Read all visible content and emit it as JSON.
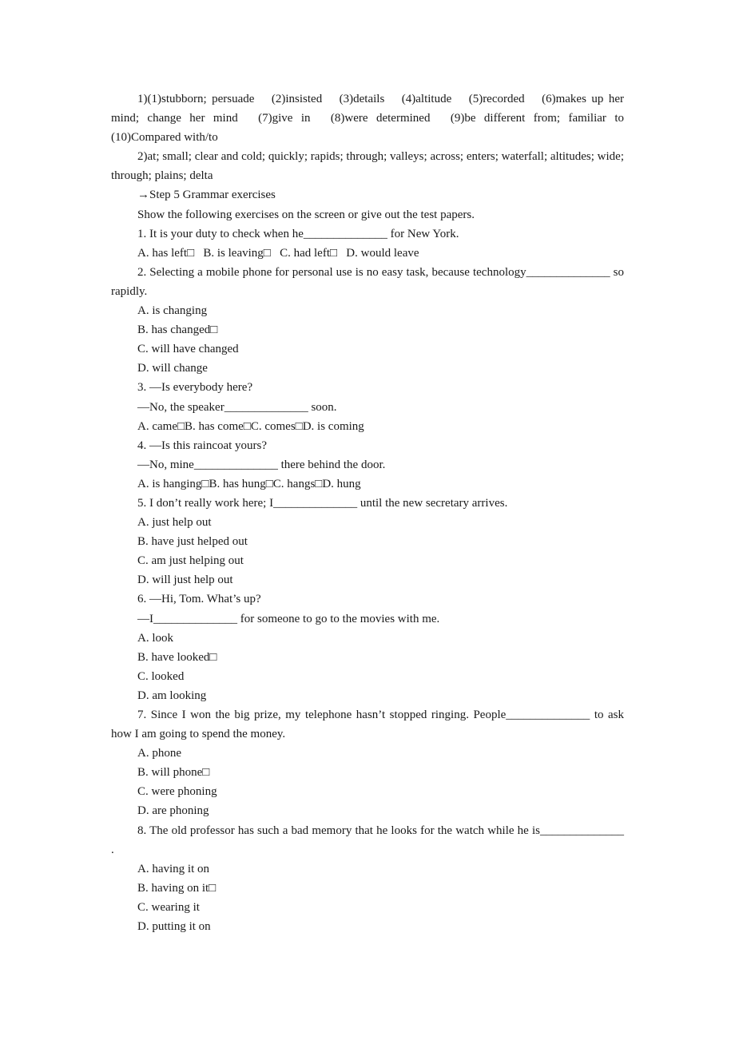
{
  "answers": {
    "part1": "1)(1)stubborn; persuade  (2)insisted  (3)details  (4)altitude  (5)recorded  (6)makes up her mind; change her mind  (7)give in  (8)were determined  (9)be different from; familiar to (10)Compared with/to",
    "part2": "2)at; small; clear and cold; quickly; rapids; through; valleys; across; enters; waterfall; altitudes; wide; through; plains; delta"
  },
  "step_heading": "→Step 5 Grammar exercises",
  "instruction": "Show the following exercises on the screen or give out the test papers.",
  "questions": [
    {
      "stem": "1. It is your duty to check when he______________ for New York.",
      "options_inline": "A. has left□   B. is leaving□   C. had left□   D. would leave"
    },
    {
      "stem": "2. Selecting a mobile phone for personal use is no easy task, because technology______________ so rapidly.",
      "options": [
        "A. is changing",
        "B. has changed□",
        "C. will have changed",
        "D. will change"
      ]
    },
    {
      "stem": "3. —Is everybody here?",
      "stem2": "—No, the speaker______________ soon.",
      "options_inline": "A. came□B. has come□C. comes□D. is coming"
    },
    {
      "stem": "4. —Is this raincoat yours?",
      "stem2": "—No, mine______________ there behind the door.",
      "options_inline": "A. is hanging□B. has hung□C. hangs□D. hung"
    },
    {
      "stem": "5. I don’t really work here; I______________ until the new secretary arrives.",
      "options": [
        "A. just help out",
        "B. have just helped out",
        "C. am just helping out",
        "D. will just help out"
      ]
    },
    {
      "stem": "6. —Hi, Tom. What’s up?",
      "stem2": "—I______________ for someone to go to the movies with me.",
      "options": [
        "A. look",
        "B. have looked□",
        "C. looked",
        "D. am looking"
      ]
    },
    {
      "stem": "7. Since I won the big prize, my telephone hasn’t stopped ringing. People______________ to ask how I am going to spend the money.",
      "options": [
        "A. phone",
        "B. will phone□",
        "C. were phoning",
        "D. are phoning"
      ]
    },
    {
      "stem": "8. The old professor has such a bad memory that he looks for the watch while he is______________    .",
      "options": [
        "A. having it on",
        "B. having on it□",
        "C. wearing it",
        "D. putting it on"
      ]
    }
  ]
}
